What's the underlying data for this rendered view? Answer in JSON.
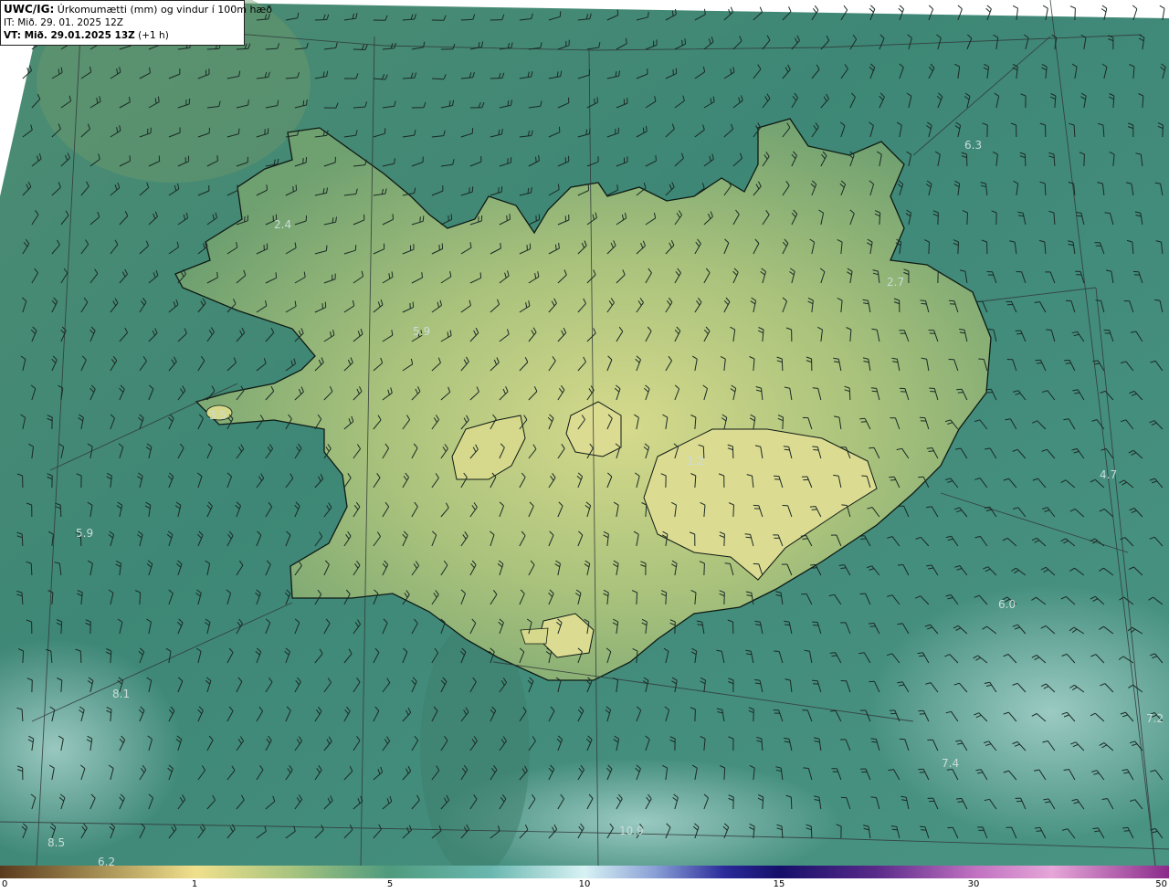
{
  "header": {
    "product": "UWC/IG:",
    "title": "Úrkomumætti (mm) og vindur í 100m hæð",
    "init_time": "IT: Mið. 29. 01. 2025 12Z",
    "valid_prefix": "VT: Mið. 29.01.2025 13Z",
    "valid_suffix": "(+1 h)"
  },
  "colors": {
    "sea": "#3f8a78",
    "land": "#8fb273",
    "highland": "#d4d88a",
    "coast": "#0e1a14",
    "grid": "#303838",
    "barb": "#1a2a24",
    "label": "#c9ddd8"
  },
  "value_labels": [
    "6.3",
    "2.4",
    "5.9",
    "2.7",
    "3.5",
    "4.7",
    "5.9",
    "6.0",
    "8.1",
    "7.2",
    "7.4",
    "8.5",
    "10.9",
    "6.2",
    "1.2"
  ],
  "colorbar": {
    "ticks": [
      "0",
      "1",
      "5",
      "10",
      "15",
      "30",
      "50"
    ]
  }
}
